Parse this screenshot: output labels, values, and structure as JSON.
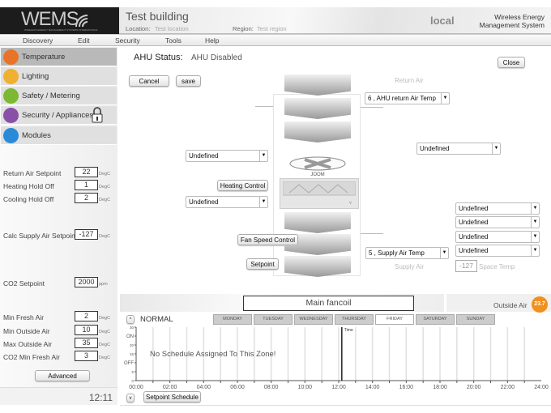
{
  "logo": {
    "text": "WEMS",
    "tagline": "WIRELESS ENERGY MANAGEMENT SYSTEMS INTERNATIONAL"
  },
  "header": {
    "title": "Test building",
    "location_label": "Location:",
    "location": "Test location",
    "region_label": "Region:",
    "region": "Test region",
    "mode": "local",
    "system_name_1": "Wireless Energy",
    "system_name_2": "Management System"
  },
  "menu": [
    "Discovery",
    "Edit",
    "Security",
    "Tools",
    "Help"
  ],
  "sidebar": {
    "items": [
      {
        "label": "Temperature",
        "color": "#e8742a",
        "selected": true
      },
      {
        "label": "Lighting",
        "color": "#f0b030"
      },
      {
        "label": "Safety / Metering",
        "color": "#7cb832"
      },
      {
        "label": "Security / Appliances",
        "color": "#8a50a8",
        "locked": true
      },
      {
        "label": "Modules",
        "color": "#2a8ad8"
      }
    ],
    "fields": [
      {
        "label": "Return Air Setpoint",
        "value": "22",
        "unit": "DegC"
      },
      {
        "label": "Heating Hold Off",
        "value": "1",
        "unit": "DegC"
      },
      {
        "label": "Cooling Hold Off",
        "value": "2",
        "unit": "DegC"
      },
      {
        "label": "Calc Supply Air Setpoint",
        "value": "-127",
        "unit": "DegC"
      },
      {
        "label": "CO2 Setpoint",
        "value": "2000",
        "unit": "ppm"
      },
      {
        "label": "Min Fresh Air",
        "value": "2",
        "unit": "DegC"
      },
      {
        "label": "Min Outside Air",
        "value": "10",
        "unit": "DegC"
      },
      {
        "label": "Max Outside Air",
        "value": "35",
        "unit": "DegC"
      },
      {
        "label": "CO2 Min Fresh Air",
        "value": "3",
        "unit": "DegC"
      }
    ],
    "advanced_label": "Advanced",
    "clock": "12:11"
  },
  "main": {
    "status_label": "AHU Status:",
    "status": "AHU Disabled",
    "close": "Close",
    "cancel": "Cancel",
    "save": "save",
    "return_air": "Return Air",
    "return_sensor": "6 , AHU return Air Temp",
    "left_select_1": "Undefined",
    "left_select_2": "Undefined",
    "right_select": "Undefined",
    "right_selects": [
      "Undefined",
      "Undefined",
      "Undefined",
      "Undefined"
    ],
    "heating_control": "Heating Control",
    "fan_speed_control": "Fan Speed Control",
    "setpoint": "Setpoint",
    "supply_sensor": "5 , Supply Air Temp",
    "supply_air": "Supply Air",
    "space_temp_value": "-127",
    "space_temp": "Space Temp",
    "fan_brand": "JOOM"
  },
  "schedule": {
    "zone": "Main fancoil",
    "outside_air_label": "Outside Air",
    "outside_air": "23.7",
    "outside_air_color": "#f0901e",
    "mode": "NORMAL",
    "days": [
      "MONDAY",
      "TUESDAY",
      "WEDNESDAY",
      "THURSDAY",
      "FRIDAY",
      "SATURDAY",
      "SUNDAY"
    ],
    "active_day": "FRIDAY",
    "message": "No Schedule Assigned To This Zone!",
    "time_label": "Time",
    "current_time": "12:11",
    "y_ticks": [
      "30",
      "ON",
      "20",
      "15",
      "OFF",
      "5",
      "0"
    ],
    "x_ticks": [
      "00:00",
      "02:00",
      "04:00",
      "06:00",
      "08:00",
      "10:00",
      "12:00",
      "14:00",
      "16:00",
      "18:00",
      "20:00",
      "22:00",
      "24:00"
    ],
    "setpoint_schedule": "Setpoint Schedule",
    "up": "^",
    "down": "v"
  }
}
